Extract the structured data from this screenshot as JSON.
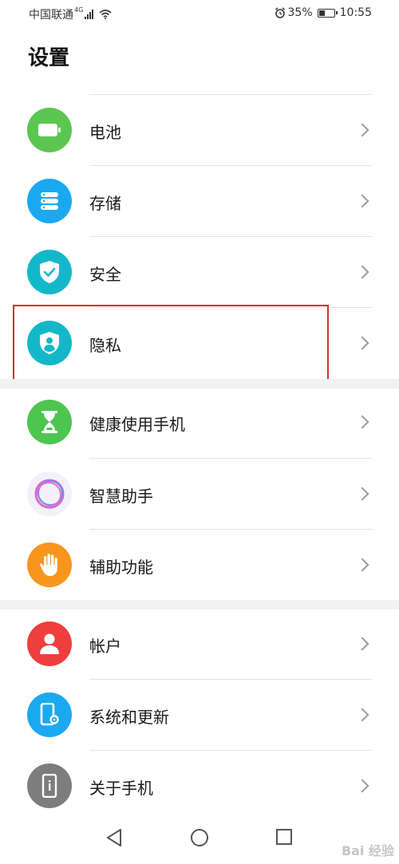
{
  "status": {
    "carrier": "中国联通",
    "network": "4G",
    "battery_pct": "35%",
    "time": "10:55"
  },
  "page_title": "设置",
  "items": [
    {
      "label": "电池",
      "icon": "battery-icon",
      "color": "#5cc651"
    },
    {
      "label": "存储",
      "icon": "storage-icon",
      "color": "#1aa9f0"
    },
    {
      "label": "安全",
      "icon": "shield-check-icon",
      "color": "#13b8c8"
    },
    {
      "label": "隐私",
      "icon": "privacy-shield-icon",
      "color": "#13b8c8"
    },
    {
      "label": "健康使用手机",
      "icon": "hourglass-icon",
      "color": "#4dc54f"
    },
    {
      "label": "智慧助手",
      "icon": "assistant-ring-icon",
      "color": "#f4f0fb"
    },
    {
      "label": "辅助功能",
      "icon": "hand-icon",
      "color": "#f8951d"
    },
    {
      "label": "帐户",
      "icon": "account-icon",
      "color": "#ee3e3e"
    },
    {
      "label": "系统和更新",
      "icon": "phone-settings-icon",
      "color": "#1aa9f0"
    },
    {
      "label": "关于手机",
      "icon": "phone-info-icon",
      "color": "#7d7d7d"
    }
  ],
  "watermark": "Bai 经验"
}
